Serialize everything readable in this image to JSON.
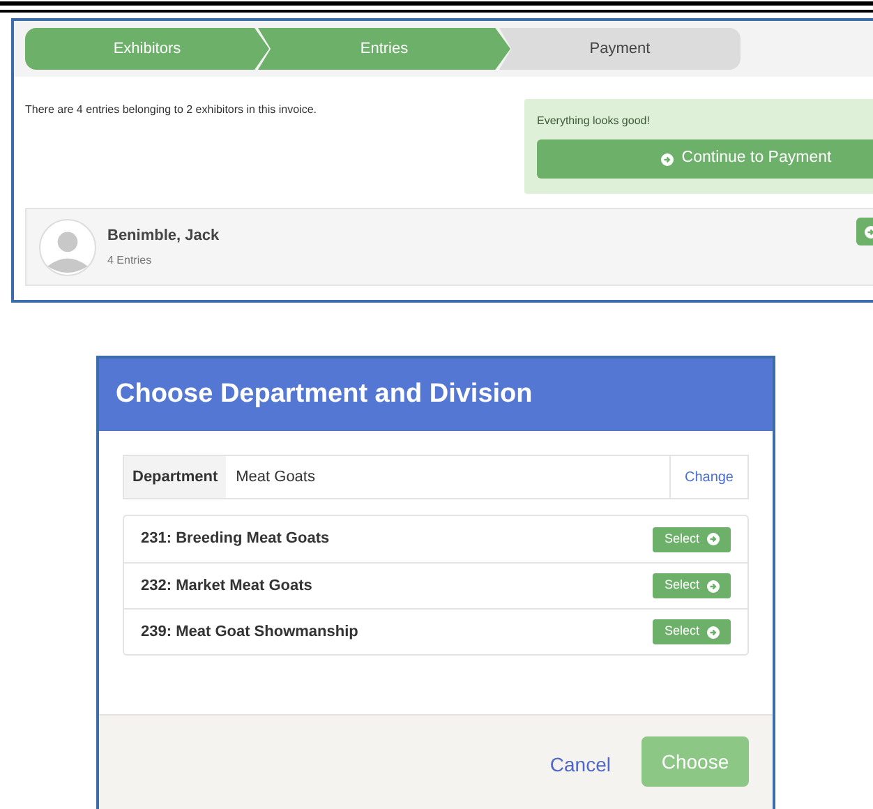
{
  "steps": [
    {
      "label": "Exhibitors",
      "done": true
    },
    {
      "label": "Entries",
      "done": true
    },
    {
      "label": "Payment",
      "done": false
    }
  ],
  "summary": "There are 4 entries belonging to 2 exhibitors in this invoice.",
  "status": {
    "message": "Everything looks good!",
    "button": "Continue to Payment"
  },
  "exhibitor": {
    "name": "Benimble, Jack",
    "entries": "4 Entries"
  },
  "dialog": {
    "title": "Choose Department and Division",
    "department": {
      "label": "Department",
      "value": "Meat Goats",
      "action": "Change"
    },
    "divisions": [
      {
        "name": "231: Breeding Meat Goats",
        "button": "Select"
      },
      {
        "name": "232: Market Meat Goats",
        "button": "Select"
      },
      {
        "name": "239: Meat Goat Showmanship",
        "button": "Select"
      }
    ],
    "cancel": "Cancel",
    "choose": {
      "label": "Choose",
      "disabled": true
    }
  }
}
